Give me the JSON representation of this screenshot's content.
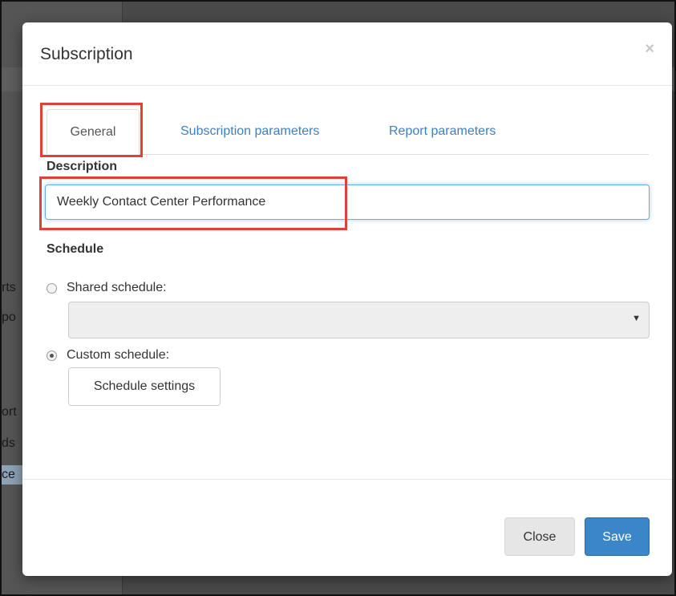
{
  "backdrop": {
    "fragments": [
      "rts",
      "po",
      "ort",
      "ds",
      "ce"
    ]
  },
  "modal": {
    "title": "Subscription",
    "close_icon": "×",
    "tabs": [
      {
        "label": "General",
        "active": true
      },
      {
        "label": "Subscription parameters",
        "active": false
      },
      {
        "label": "Report parameters",
        "active": false
      }
    ],
    "description": {
      "label": "Description",
      "value": "Weekly Contact Center Performance"
    },
    "schedule": {
      "label": "Schedule",
      "shared_label": "Shared schedule:",
      "shared_selected": false,
      "shared_select_value": "",
      "custom_label": "Custom schedule:",
      "custom_selected": true,
      "settings_button": "Schedule settings"
    },
    "footer": {
      "close_label": "Close",
      "save_label": "Save"
    }
  },
  "colors": {
    "highlight_border": "#e0403a",
    "primary": "#3b86c8",
    "link": "#3c80c4"
  }
}
